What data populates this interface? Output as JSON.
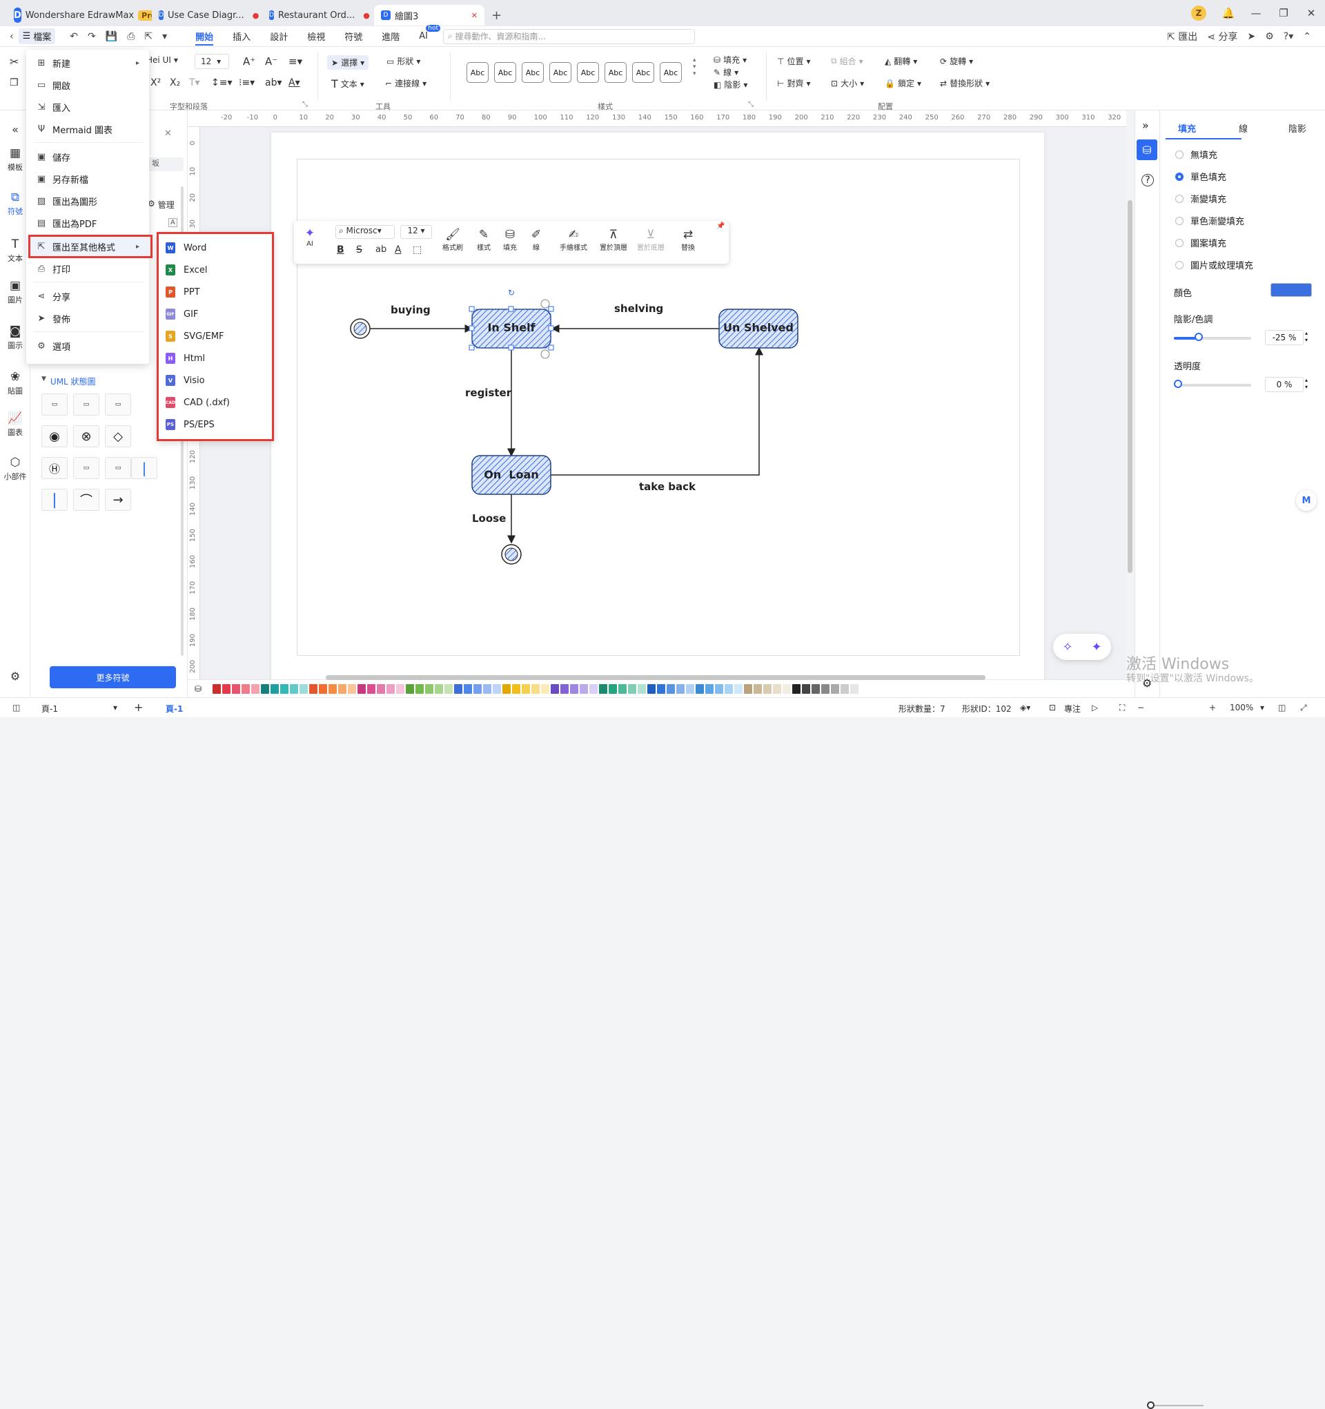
{
  "titlebar": {
    "app_name": "Wondershare EdrawMax",
    "pro_badge": "Pro",
    "tabs": [
      {
        "label": "Use Case Diagr..."
      },
      {
        "label": "Restaurant Ord..."
      },
      {
        "label": "繪圖3"
      }
    ],
    "avatar_letter": "Z"
  },
  "menubar": {
    "file_label": "檔案",
    "tabs": [
      "開始",
      "插入",
      "設計",
      "檢視",
      "符號",
      "進階",
      "AI"
    ],
    "ai_badge": "hot",
    "search_placeholder": "搜尋動作、資源和指南...",
    "export_label": "匯出",
    "share_label": "分享"
  },
  "ribbon": {
    "font_name": "Hei UI",
    "font_size": "12",
    "group_font": "字型和段落",
    "select_label": "選擇",
    "shape_label": "形狀",
    "text_label": "文本",
    "connector_label": "連接線",
    "group_tools": "工具",
    "style_samples": [
      "Abc",
      "Abc",
      "Abc",
      "Abc",
      "Abc",
      "Abc",
      "Abc",
      "Abc"
    ],
    "group_style": "樣式",
    "fill_label": "填充",
    "line_label": "線",
    "shadow_label": "陰影",
    "position_label": "位置",
    "group_label": "組合",
    "flip_label": "翻轉",
    "rotate_label": "旋轉",
    "align_label": "對齊",
    "size_label": "大小",
    "lock_label": "鎖定",
    "replace_label": "替換形狀",
    "group_arrange": "配置"
  },
  "leftrail": [
    "模板",
    "符號",
    "文本",
    "圖片",
    "圖示",
    "貼圖",
    "圖表",
    "小部件"
  ],
  "library": {
    "manage_label": "管理",
    "category": "UML 狀態圖",
    "more_button": "更多符號"
  },
  "file_menu": {
    "items": [
      "新建",
      "開啟",
      "匯入",
      "Mermaid 圖表",
      "儲存",
      "另存新檔",
      "匯出為圖形",
      "匯出為PDF",
      "匯出至其他格式",
      "打印",
      "分享",
      "發佈",
      "選項"
    ]
  },
  "export_submenu": {
    "items": [
      {
        "label": "Word",
        "color": "#2b5fd9",
        "abbr": "W"
      },
      {
        "label": "Excel",
        "color": "#1f8a4c",
        "abbr": "X"
      },
      {
        "label": "PPT",
        "color": "#e0572a",
        "abbr": "P"
      },
      {
        "label": "GIF",
        "color": "#8f8ad8",
        "abbr": "GIF"
      },
      {
        "label": "SVG/EMF",
        "color": "#e8a521",
        "abbr": "S"
      },
      {
        "label": "Html",
        "color": "#8b5cf6",
        "abbr": "H"
      },
      {
        "label": "Visio",
        "color": "#4f6bdc",
        "abbr": "V"
      },
      {
        "label": "CAD (.dxf)",
        "color": "#e24a6a",
        "abbr": "CAD"
      },
      {
        "label": "PS/EPS",
        "color": "#5b5fd6",
        "abbr": "PS"
      }
    ]
  },
  "floatbar": {
    "ai_label": "AI",
    "font": "Microsc",
    "size": "12",
    "buttons": [
      "格式刷",
      "樣式",
      "填充",
      "線",
      "手繪樣式",
      "置於頂層",
      "置於底層",
      "替換"
    ]
  },
  "ruler": {
    "top": [
      "-20",
      "-10",
      "0",
      "10",
      "20",
      "30",
      "40",
      "50",
      "60",
      "70",
      "80",
      "90",
      "100",
      "110",
      "120",
      "130",
      "140",
      "150",
      "160",
      "170",
      "180",
      "190",
      "200",
      "210",
      "220",
      "230",
      "240",
      "250",
      "260",
      "270",
      "280",
      "290",
      "300",
      "310",
      "320"
    ],
    "left": [
      "0",
      "10",
      "20",
      "30",
      "120",
      "130",
      "140",
      "150",
      "160",
      "170",
      "180",
      "190",
      "200"
    ]
  },
  "diagram": {
    "states": [
      "In Shelf",
      "Un Shelved",
      "On  Loan"
    ],
    "transitions": [
      "buying",
      "shelving",
      "register",
      "take back",
      "Loose"
    ]
  },
  "rightpanel": {
    "tabs": [
      "填充",
      "線",
      "陰影"
    ],
    "options": [
      "無填充",
      "單色填充",
      "漸變填充",
      "單色漸變填充",
      "圖案填充",
      "圖片或紋理填充"
    ],
    "selected_option": "單色填充",
    "color_label": "顏色",
    "color_value": "#3a6fe0",
    "shade_label": "陰影/色調",
    "shade_value": "-25 %",
    "shade_level": 0.25,
    "transparency_label": "透明度",
    "transparency_value": "0 %",
    "transparency_level": 0.0
  },
  "palette": [
    "#c9302c",
    "#e53a4b",
    "#e8536d",
    "#f07c8a",
    "#f4a3ae",
    "#17807f",
    "#1fa0a0",
    "#34b7b7",
    "#62c9c9",
    "#9edcdc",
    "#e4572e",
    "#f06d2f",
    "#f58b45",
    "#f7a86c",
    "#f9c497",
    "#c7397c",
    "#db4f91",
    "#e47aaa",
    "#ec9fc2",
    "#f4c5da",
    "#5aa13a",
    "#72b84d",
    "#8dc86b",
    "#a9d68e",
    "#c6e4b3",
    "#3d6ed8",
    "#4f86ea",
    "#75a0ef",
    "#9bbaf3",
    "#c0d4f7",
    "#e0a800",
    "#f0bf1a",
    "#f5cf4f",
    "#f8dd84",
    "#fbebb9",
    "#6a4bc4",
    "#8262d6",
    "#9f86e0",
    "#bca9ea",
    "#dacff4",
    "#1a8b6d",
    "#23a57f",
    "#4cb998",
    "#7fcdb3",
    "#b3e1cf",
    "#1f5fbf",
    "#2f74d6",
    "#5a93e0",
    "#86b1ea",
    "#b2cff4",
    "#3a8ad6",
    "#5aa6e8",
    "#80bdee",
    "#a8d3f4",
    "#cfe8fa",
    "#b8a37c",
    "#c9b795",
    "#d8cbaf",
    "#e7dfc9",
    "#f3eee2",
    "#222222",
    "#444444",
    "#666666",
    "#888888",
    "#aaaaaa",
    "#cccccc",
    "#e6e6e6"
  ],
  "statusbar": {
    "page_select": "頁-1",
    "page_tab": "頁-1",
    "shape_count": "形狀數量：7",
    "shape_id": "形狀ID：102",
    "focus_label": "專注",
    "zoom": "100%"
  },
  "watermark": {
    "line1": "激活 Windows",
    "line2": "转到\"设置\"以激活 Windows。"
  }
}
